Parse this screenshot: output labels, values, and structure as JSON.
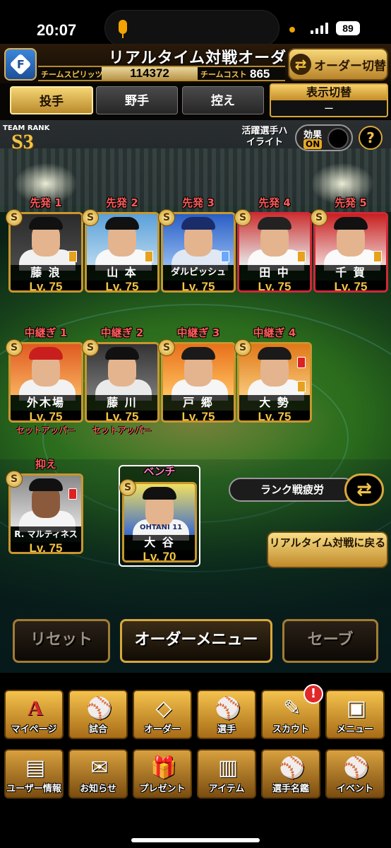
{
  "status": {
    "time": "20:07",
    "battery": "89"
  },
  "header": {
    "title": "リアルタイム対戦オーダー",
    "spirits_label": "チームスピリッツ",
    "spirits_value": "114372",
    "cost_label": "チームコスト",
    "cost_value": "865",
    "order_switch_label": "オーダー切替",
    "logo_letter": "F"
  },
  "tabs": [
    {
      "label": "投手",
      "active": true
    },
    {
      "label": "野手",
      "active": false
    },
    {
      "label": "控え",
      "active": false
    }
  ],
  "display_switch": {
    "label": "表示切替",
    "value": "ー"
  },
  "team_rank": {
    "label": "TEAM RANK",
    "value": "S3"
  },
  "highlight": {
    "label": "活躍選手ハイライト",
    "effect_label": "効果",
    "effect_state": "ON"
  },
  "starters": [
    {
      "position": "先発 1",
      "name": "藤 浪",
      "level": "Lv. 75",
      "badge": "S",
      "chip": "orange"
    },
    {
      "position": "先発 2",
      "name": "山 本",
      "level": "Lv. 75",
      "badge": "S",
      "chip": "orange"
    },
    {
      "position": "先発 3",
      "name": "ダルビッシュ",
      "level": "Lv. 75",
      "badge": "S",
      "chip": "blue"
    },
    {
      "position": "先発 4",
      "name": "田 中",
      "level": "Lv. 75",
      "badge": "S",
      "chip": "orange"
    },
    {
      "position": "先発 5",
      "name": "千 賀",
      "level": "Lv. 75",
      "badge": "S",
      "chip": "orange"
    }
  ],
  "relievers": [
    {
      "position": "中継ぎ 1",
      "name": "外木場",
      "level": "Lv. 75",
      "badge": "S",
      "role": "セットアッパー",
      "chip": "none"
    },
    {
      "position": "中継ぎ 2",
      "name": "藤 川",
      "level": "Lv. 75",
      "badge": "S",
      "role": "セットアッパー",
      "chip": "none"
    },
    {
      "position": "中継ぎ 3",
      "name": "戸 郷",
      "level": "Lv. 75",
      "badge": "S",
      "role": "",
      "chip": "none"
    },
    {
      "position": "中継ぎ 4",
      "name": "大 勢",
      "level": "Lv. 75",
      "badge": "S",
      "role": "",
      "chip": "home"
    }
  ],
  "closer": {
    "position": "抑え",
    "name": "R. マルティネス",
    "level": "Lv. 75",
    "badge": "S"
  },
  "bench": {
    "position": "ベンチ",
    "name": "大 谷",
    "level": "Lv. 70",
    "badge": "S",
    "jersey": "OHTANI 11"
  },
  "rank_fatigue": "ランク戦疲労",
  "back_button": "リアルタイム対戦に戻る",
  "actions": {
    "reset": "リセット",
    "order_menu": "オーダーメニュー",
    "save": "セーブ"
  },
  "nav_row1": [
    {
      "label": "マイページ",
      "icon": "A"
    },
    {
      "label": "試合",
      "icon": "⚾"
    },
    {
      "label": "オーダー",
      "icon": "◇"
    },
    {
      "label": "選手",
      "icon": "⚾"
    },
    {
      "label": "スカウト",
      "icon": "✎",
      "alert": "!"
    },
    {
      "label": "メニュー",
      "icon": "▣"
    }
  ],
  "nav_row2": [
    {
      "label": "ユーザー情報",
      "icon": "▤"
    },
    {
      "label": "お知らせ",
      "icon": "✉"
    },
    {
      "label": "プレゼント",
      "icon": "🎁"
    },
    {
      "label": "アイテム",
      "icon": "▥"
    },
    {
      "label": "選手名鑑",
      "icon": "⚾"
    },
    {
      "label": "イベント",
      "icon": "⚾"
    }
  ]
}
